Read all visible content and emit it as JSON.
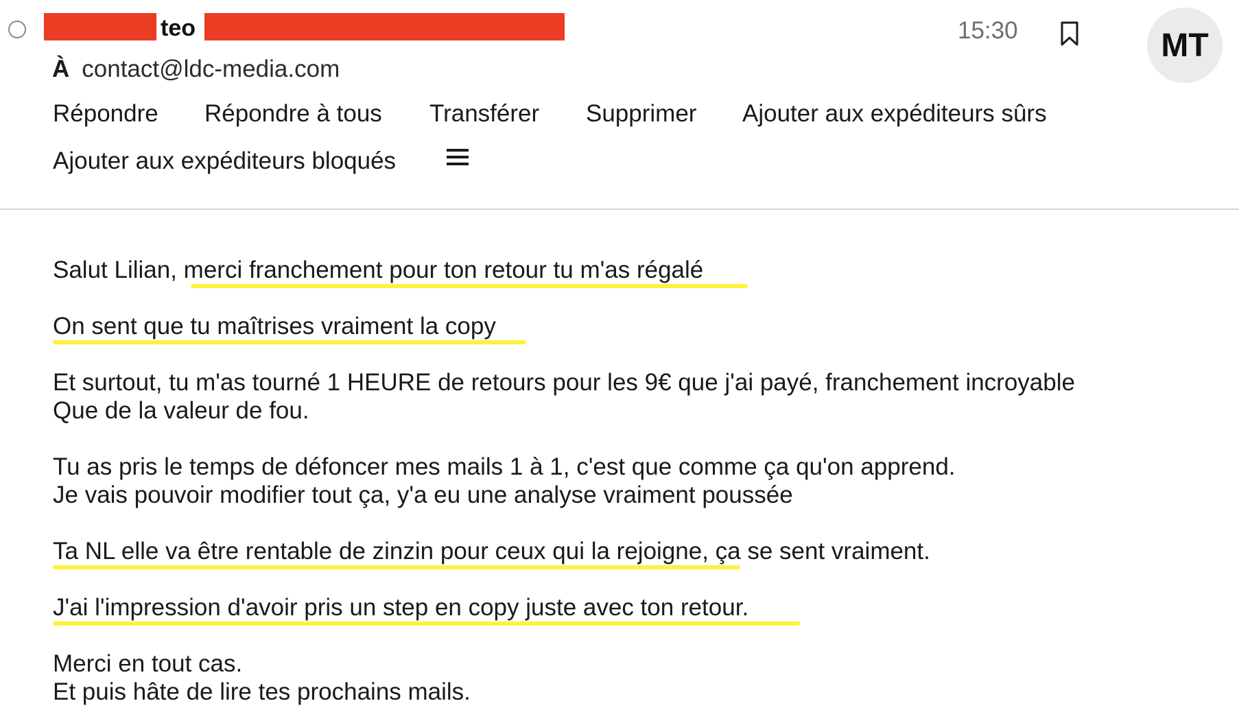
{
  "header": {
    "sender_visible": "teo",
    "time": "15:30",
    "avatar_initials": "MT",
    "to_label": "À",
    "to_address": "contact@ldc-media.com",
    "redaction_color": "#ea3d23"
  },
  "actions": {
    "reply": "Répondre",
    "reply_all": "Répondre à tous",
    "forward": "Transférer",
    "delete": "Supprimer",
    "add_safe_senders": "Ajouter aux expéditeurs sûrs",
    "add_blocked_senders": "Ajouter aux expéditeurs bloqués",
    "more_icon": "hamburger-menu-icon"
  },
  "icons": {
    "bookmark": "bookmark-icon",
    "select": "radio-circle-icon"
  },
  "body": {
    "lines": [
      "Salut Lilian, merci franchement pour ton retour tu m'as régalé",
      "On sent que tu maîtrises vraiment la copy",
      "Et surtout, tu m'as tourné 1 HEURE de retours pour les 9€ que j'ai payé, franchement incroyable",
      "Que de la valeur de fou.",
      "Tu as pris le temps de défoncer mes mails 1 à 1, c'est que comme ça qu'on apprend.",
      "Je vais pouvoir modifier tout ça, y'a eu une analyse vraiment poussée",
      "Ta NL elle va être rentable de zinzin pour ceux qui la rejoigne, ça se sent vraiment.",
      "J'ai l'impression d'avoir pris un step en copy juste avec ton retour.",
      "Merci en tout cas.",
      "Et puis hâte de lire tes prochains mails."
    ],
    "highlight_color": "#fff23a"
  }
}
